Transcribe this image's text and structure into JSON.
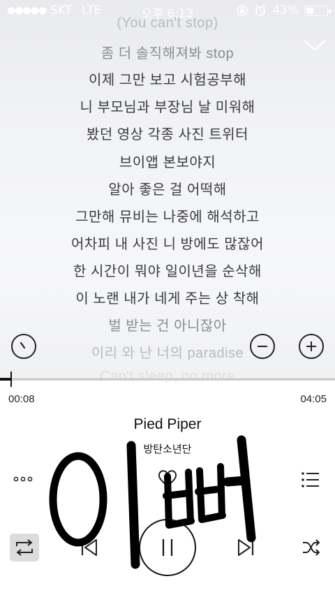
{
  "status_bar": {
    "signal_dots": "●●●●●",
    "carrier": "SKT",
    "network": "LTE",
    "time": "오후 6:13",
    "battery": "43%",
    "battery_level": 0.43
  },
  "lyrics": {
    "lines": [
      "(You can't stop)",
      "좀 더 솔직해져봐 stop",
      "이제 그만 보고 시험공부해",
      "니 부모님과 부장님 날 미워해",
      "봤던 영상 각종 사진 트위터",
      "브이앱 본보야지",
      "알아 좋은 걸 어떡해",
      "그만해 뮤비는 나중에 해석하고",
      "어차피 내 사진 니 방에도 많잖어",
      "한 시간이 뭐야 일이년을 순삭해",
      "이 노랜 내가 네게 주는 상 착해",
      "벌 받는 건 아니잖아",
      "이리 와 난 너의 paradise",
      "Can't sleep, no more"
    ]
  },
  "player": {
    "elapsed": "00:08",
    "total": "04:05",
    "progress": 0.033,
    "title": "Pied Piper",
    "artist": "방탄소년단"
  },
  "overlay": {
    "doodle_text": "이뻐"
  },
  "icons": {
    "collapse": "chevron-down-icon",
    "timer": "timer-icon",
    "font_smaller": "minus-circle-icon",
    "font_larger": "plus-circle-icon",
    "more": "more-icon",
    "like": "heart-icon",
    "playlist": "playlist-icon",
    "repeat": "repeat-icon",
    "previous": "previous-icon",
    "pause": "pause-icon",
    "next": "next-icon",
    "shuffle": "shuffle-icon"
  },
  "colors": {
    "accent": "#111111",
    "track": "#cfcfcf",
    "repeat_active_bg": "#dcdcdc"
  }
}
